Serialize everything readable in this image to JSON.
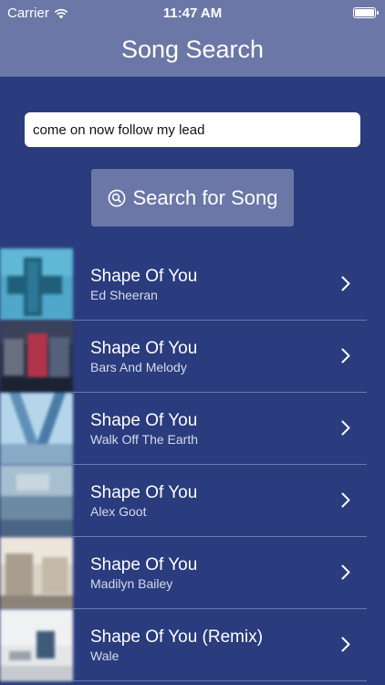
{
  "status_bar": {
    "carrier": "Carrier",
    "time": "11:47 AM",
    "wifi_icon": "wifi-icon",
    "battery_level": 1.0
  },
  "nav": {
    "title": "Song Search"
  },
  "search": {
    "value": "come on now follow my lead",
    "button_label": "Search for Song",
    "button_icon": "search-icon"
  },
  "colors": {
    "background": "#2a3b7e",
    "bar": "#6b77a6",
    "button": "#6b77a6",
    "divider": "#6d7aae"
  },
  "results": [
    {
      "title": "Shape Of You",
      "artist": "Ed Sheeran"
    },
    {
      "title": "Shape Of You",
      "artist": "Bars And Melody"
    },
    {
      "title": "Shape Of You",
      "artist": "Walk Off The Earth"
    },
    {
      "title": "Shape Of You",
      "artist": "Alex Goot"
    },
    {
      "title": "Shape Of You",
      "artist": "Madilyn Bailey"
    },
    {
      "title": "Shape Of You (Remix)",
      "artist": "Wale"
    }
  ]
}
